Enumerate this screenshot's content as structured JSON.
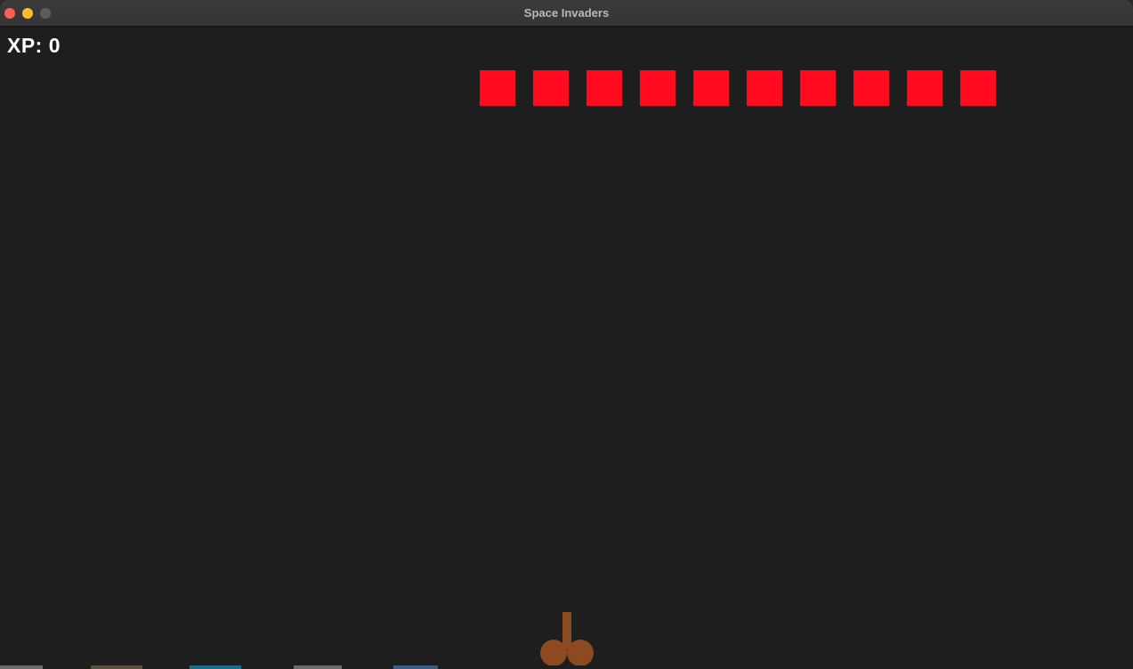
{
  "window": {
    "title": "Space Invaders"
  },
  "hud": {
    "score_text": "XP: 0"
  },
  "invaders": {
    "count": 10,
    "color": "#ff0a1e"
  },
  "player": {
    "color": "#8b4a1f",
    "icon": "ship-icon"
  },
  "colors": {
    "background": "#1e1e1e",
    "hud_text": "#ffffff"
  }
}
